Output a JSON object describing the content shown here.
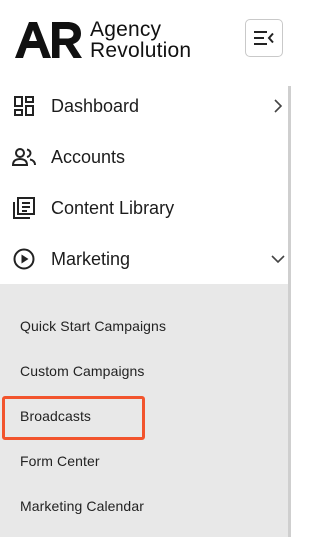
{
  "brand": {
    "logo_letters": "AR",
    "name_line1": "Agency",
    "name_line2": "Revolution"
  },
  "header": {
    "menu_toggle_icon": "menu-collapse-icon"
  },
  "nav": {
    "items": [
      {
        "label": "Dashboard",
        "icon": "dashboard-grid-icon",
        "chevron": "chevron-right-icon"
      },
      {
        "label": "Accounts",
        "icon": "people-icon"
      },
      {
        "label": "Content Library",
        "icon": "library-icon"
      },
      {
        "label": "Marketing",
        "icon": "play-circle-icon",
        "chevron": "chevron-down-icon"
      }
    ]
  },
  "submenu": {
    "items": [
      {
        "label": "Quick Start Campaigns"
      },
      {
        "label": "Custom Campaigns"
      },
      {
        "label": "Broadcasts",
        "highlighted": true
      },
      {
        "label": "Form Center"
      },
      {
        "label": "Marketing Calendar"
      }
    ]
  },
  "colors": {
    "highlight": "#f2542d",
    "submenu_bg": "#e8e8e8",
    "text": "#1c1c1c"
  }
}
